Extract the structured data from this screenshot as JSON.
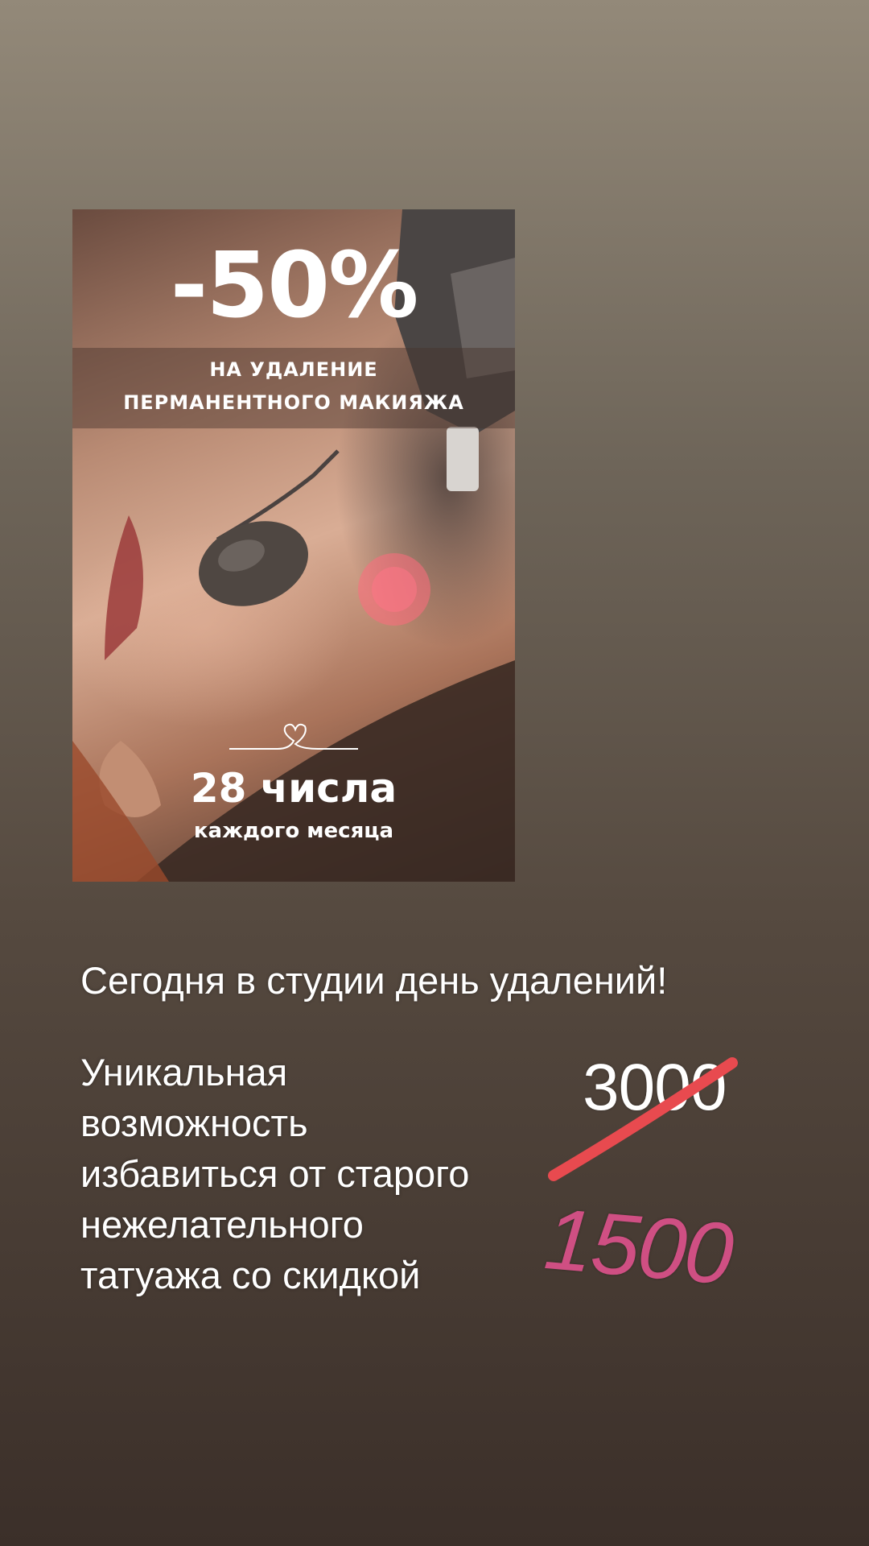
{
  "promo": {
    "discount": "-50%",
    "subtitle_line1": "НА УДАЛЕНИЕ",
    "subtitle_line2": "ПЕРМАНЕНТНОГО МАКИЯЖА",
    "date": "28 числа",
    "period": "каждого месяца",
    "heart_icon": "heart-line-icon"
  },
  "story": {
    "headline": "Сегодня в студии день удалений!",
    "body_lines": [
      "Уникальная",
      "возможность",
      "избавиться от старого",
      "нежелательного",
      "татуажа со скидкой"
    ]
  },
  "price": {
    "old": "3000",
    "new": "1500",
    "strike_color": "#e84a4f",
    "new_color": "#cf4f83"
  }
}
